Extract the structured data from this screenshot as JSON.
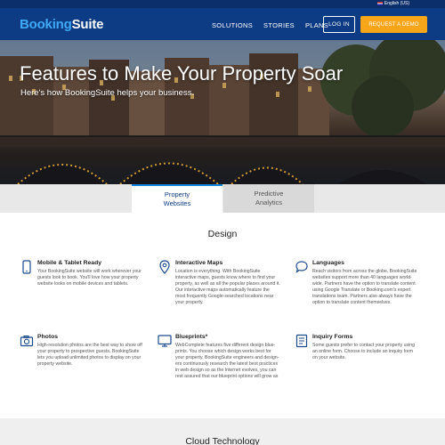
{
  "util": {
    "language": "English (US)"
  },
  "header": {
    "logo_part1": "Booking",
    "logo_part2": "Suite",
    "nav": [
      "SOLUTIONS",
      "STORIES",
      "PLANS"
    ],
    "login_label": "LOG IN",
    "demo_label": "REQUEST A DEMO"
  },
  "hero": {
    "title": "Features to Make Your Property Soar",
    "subtitle": "Here's how BookingSuite helps your business."
  },
  "tabs": [
    {
      "label_line1": "Property",
      "label_line2": "Websites",
      "active": true
    },
    {
      "label_line1": "Predictive",
      "label_line2": "Analytics",
      "active": false
    }
  ],
  "section": {
    "title": "Design"
  },
  "features": [
    {
      "icon": "mobile-icon",
      "title": "Mobile & Tablet Ready",
      "text": "Your BookingSuite website will work wherever your guests look to book. You'll love how your property website looks on mobile devices and tablets."
    },
    {
      "icon": "map-pin-icon",
      "title": "Interactive Maps",
      "text": "Location is everything. With BookingSuite interactive maps, guests know where to find your property, as well as all the popular places around it. Our interactive maps automatically feature the most frequently Google-searched locations near your property."
    },
    {
      "icon": "speech-bubble-icon",
      "title": "Languages",
      "text": "Reach visitors from across the globe. BookingSuite websites support more than 40 languages world-wide. Partners have the option to translate content using Google Translate or Booking.com's expert translations team. Partners also always have the option to translate content themselves."
    },
    {
      "icon": "camera-icon",
      "title": "Photos",
      "text": "High-resolution photos are the best way to show off your property to prospective guests. BookingSuite lets you upload unlimited photos to display on your property website."
    },
    {
      "icon": "monitor-icon",
      "title": "Blueprints*",
      "text": "WebComplete features five different design blue-prints. You choose which design works best for your property. BookingSuite engineers and design-ers continuously research the latest best practices in web design so as the Internet evolves, you can rest assured that our blueprint options will grow as"
    },
    {
      "icon": "form-icon",
      "title": "Inquiry Forms",
      "text": "Some guests prefer to contact your property using an online form. Choose to include an inquiry form on your website."
    }
  ],
  "next_section": {
    "title": "Cloud Technology"
  },
  "colors": {
    "header": "#0d3c85",
    "accent": "#3fa9f5",
    "demo_button": "#f6a618",
    "active_tab_border": "#1581d8"
  }
}
